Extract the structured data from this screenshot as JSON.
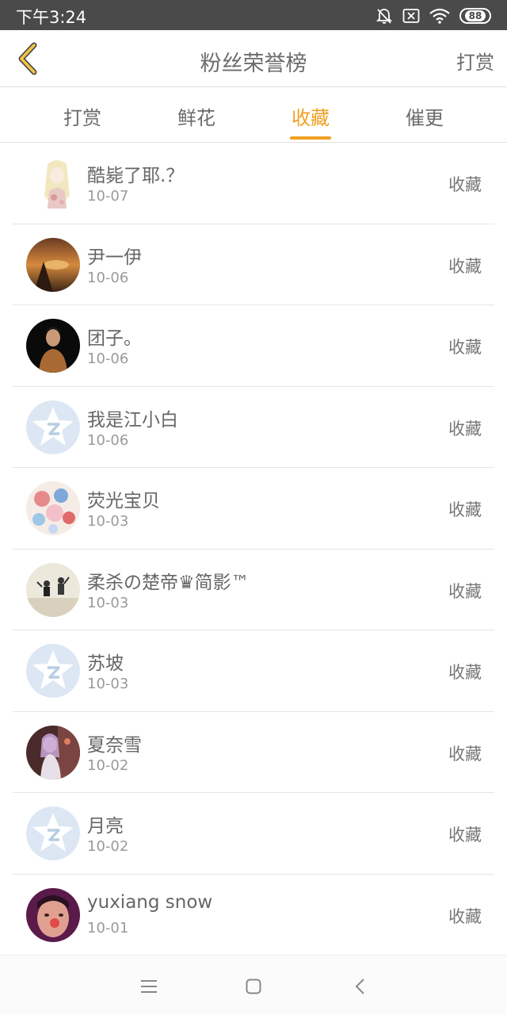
{
  "status_bar": {
    "time": "下午3:24",
    "battery": "88",
    "icons": [
      "bell-off-icon",
      "sim-x-icon",
      "wifi-icon",
      "battery-icon"
    ]
  },
  "header": {
    "title": "粉丝荣誉榜",
    "action": "打赏",
    "back_icon": "chevron-left-icon",
    "accent": "#f0a020"
  },
  "tabs": [
    {
      "label": "打赏"
    },
    {
      "label": "鲜花"
    },
    {
      "label": "收藏",
      "active": true
    },
    {
      "label": "催更"
    }
  ],
  "list": [
    {
      "name": "酷毙了耶.？",
      "date": "10-07",
      "type": "收藏",
      "avatar": "girl-illustration"
    },
    {
      "name": "尹一伊",
      "date": "10-06",
      "type": "收藏",
      "avatar": "sunset-photo"
    },
    {
      "name": "团子。",
      "date": "10-06",
      "type": "收藏",
      "avatar": "person-dark-photo"
    },
    {
      "name": "我是江小白",
      "date": "10-06",
      "type": "收藏",
      "avatar": "default-star-avatar"
    },
    {
      "name": "荧光宝贝",
      "date": "10-03",
      "type": "收藏",
      "avatar": "flower-illustration"
    },
    {
      "name": "柔杀の楚帝♛简影™",
      "date": "10-03",
      "type": "收藏",
      "avatar": "jumping-couple-photo"
    },
    {
      "name": "苏坡",
      "date": "10-03",
      "type": "收藏",
      "avatar": "default-star-avatar"
    },
    {
      "name": "夏奈雪",
      "date": "10-02",
      "type": "收藏",
      "avatar": "anime-girl-illustration"
    },
    {
      "name": "月亮",
      "date": "10-02",
      "type": "收藏",
      "avatar": "default-star-avatar"
    },
    {
      "name": "yuxiang snow",
      "date": "10-01",
      "type": "收藏",
      "avatar": "selfie-photo"
    }
  ],
  "nav_bar": {
    "icons": [
      "menu-icon",
      "home-square-icon",
      "back-chevron-icon"
    ]
  }
}
